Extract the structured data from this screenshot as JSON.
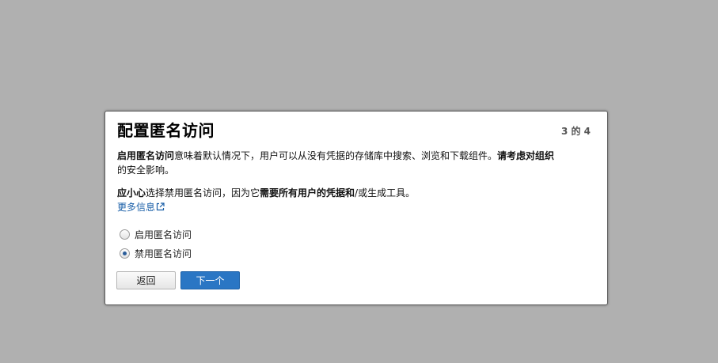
{
  "dialog": {
    "title": "配置匿名访问",
    "step": "3 的 4",
    "para1": {
      "bold_lead": "启用匿名访问",
      "text": "意味着默认情况下，用户可以从没有凭据的存储库中搜索、浏览和下载组件。",
      "bold_tail": "请考虑对组织",
      "text2": "的安全影响。"
    },
    "para2": {
      "bold_lead": "应小心",
      "text": "选择禁用匿名访问，因为它",
      "bold_mid": "需要所有用户的凭据和",
      "text2": "/或生成工具。"
    },
    "more_info_link": "更多信息",
    "options": [
      {
        "label": "启用匿名访问",
        "checked": false
      },
      {
        "label": "禁用匿名访问",
        "checked": true
      }
    ],
    "buttons": {
      "back": "返回",
      "next": "下一个"
    }
  },
  "colors": {
    "overlay": "#b0b0b0",
    "primary_button": "#2a76c4",
    "link": "#1a5fa8"
  },
  "icons": {
    "external_link": "external-link-icon"
  }
}
